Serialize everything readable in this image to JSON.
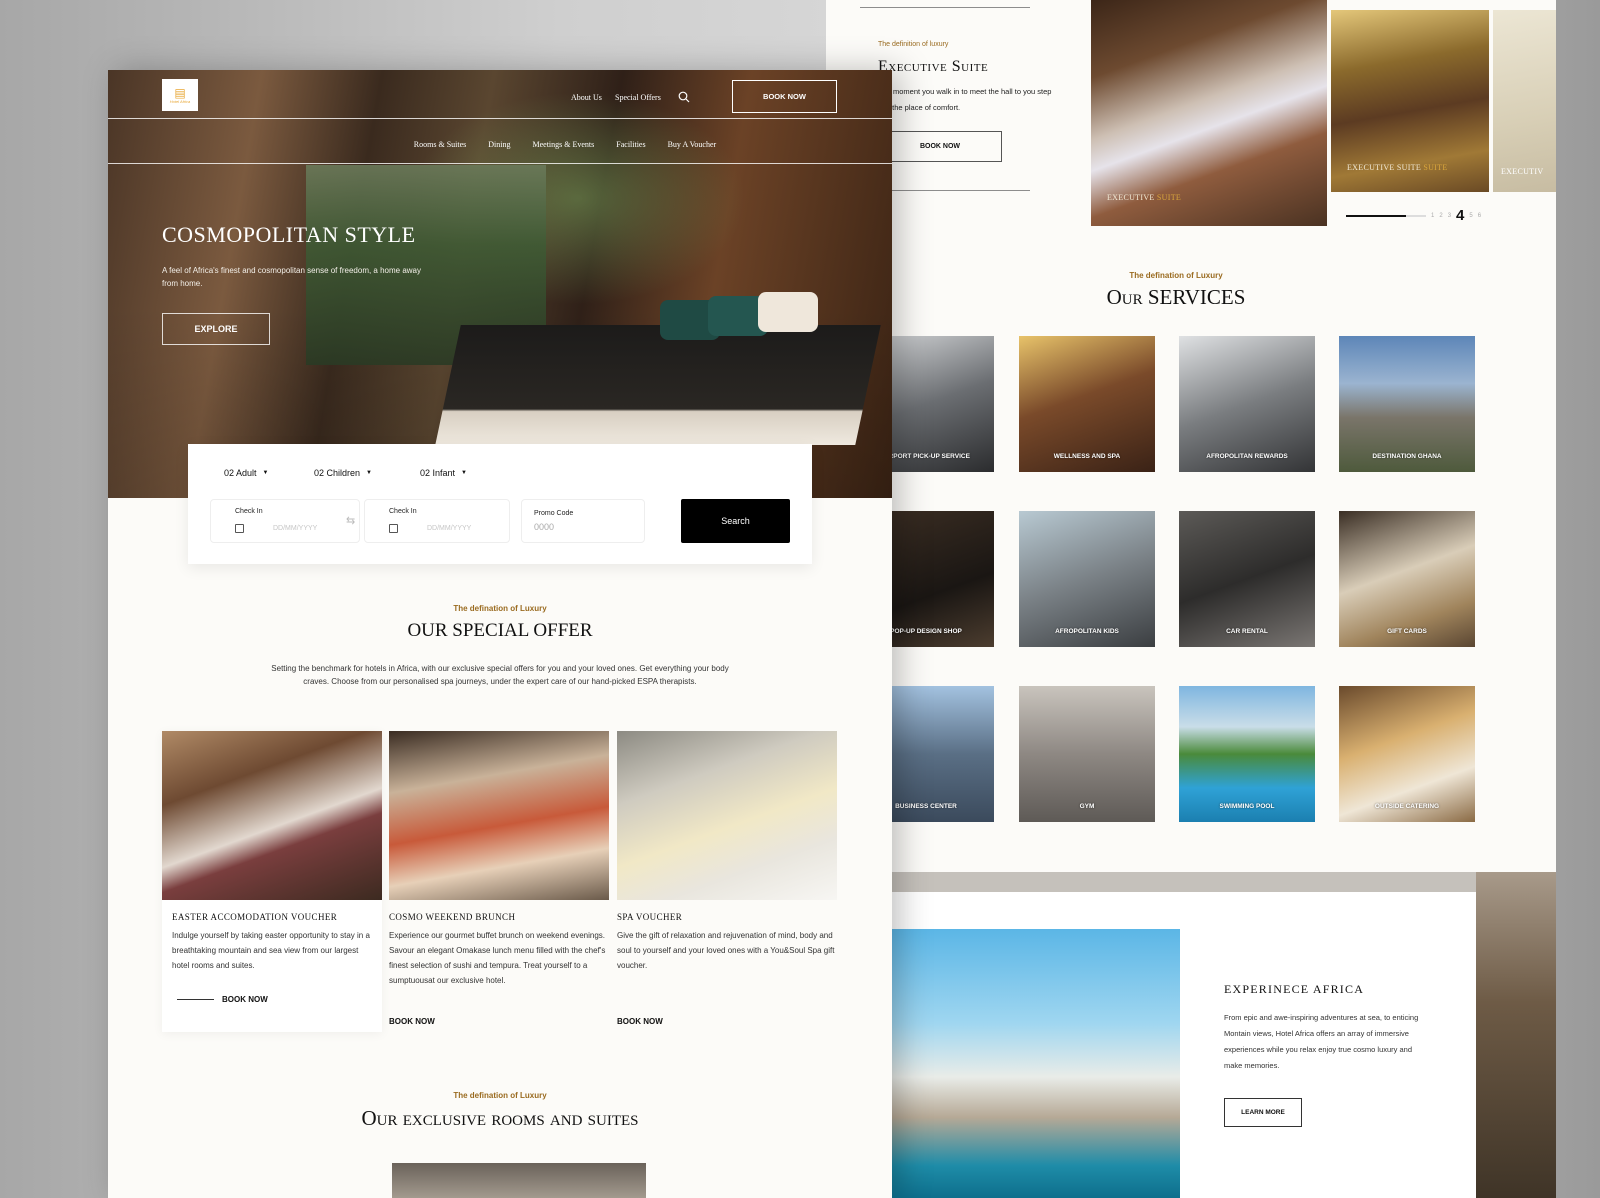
{
  "front": {
    "logo": {
      "glyph": "🏨",
      "tagline": "Hotel Africa"
    },
    "nav_top": [
      "About Us",
      "Special Offers"
    ],
    "book_now": "BOOK NOW",
    "nav_menu": [
      "Rooms & Suites",
      "Dining",
      "Meetings & Events",
      "Facilities",
      "Buy A Voucher"
    ],
    "hero": {
      "title": "COSMOPOLITAN STYLE",
      "subtitle": "A feel of Africa's finest and cosmopolitan sense of freedom, a home away from home.",
      "cta": "EXPLORE"
    },
    "booking": {
      "guests": [
        {
          "label": "02 Adult"
        },
        {
          "label": "02 Children"
        },
        {
          "label": "02 Infant"
        }
      ],
      "check_in_1": {
        "label": "Check In",
        "placeholder": "DD/MM/YYYY"
      },
      "check_in_2": {
        "label": "Check In",
        "placeholder": "DD/MM/YYYY"
      },
      "promo": {
        "label": "Promo Code",
        "placeholder": "0000"
      },
      "search": "Search"
    },
    "special_offer": {
      "eyebrow": "The defination of Luxury",
      "title": "OUR SPECIAL OFFER",
      "description": "Setting the benchmark for hotels in Africa, with our exclusive special offers for you and your loved ones. Get everything your body craves. Choose from our personalised spa journeys, under the expert care of our hand-picked ESPA therapists.",
      "offers": [
        {
          "title": "Easter Accomodation Voucher",
          "description": "Indulge yourself by taking easter opportunity to stay in a breathtaking mountain and sea view from our largest hotel rooms and suites.",
          "cta": "BOOK NOW"
        },
        {
          "title": "Cosmo Weekend Brunch",
          "description": "Experience our gourmet buffet brunch on weekend evenings. Savour an elegant Omakase lunch menu filled with the chef's finest selection of sushi and tempura. Treat yourself to a sumptuousat our exclusive hotel.",
          "cta": "BOOK NOW"
        },
        {
          "title": "Spa Voucher",
          "description": "Give the gift of relaxation and rejuvenation of mind, body and soul to yourself and your loved ones with a You&Soul Spa gift voucher.",
          "cta": "BOOK NOW"
        }
      ]
    },
    "rooms": {
      "eyebrow": "The defination of Luxury",
      "title": "Our exclusive rooms and suites"
    }
  },
  "back": {
    "suite": {
      "eyebrow": "The definition of luxury",
      "title": "Executive Suite",
      "description": "The moment you walk in to meet the hall to you step into the place of comfort.",
      "cta": "BOOK NOW"
    },
    "slides": [
      {
        "caption_main": "EXECUTIVE",
        "caption_accent": "SUITE"
      },
      {
        "caption_main": "EXECUTIVE SUITE",
        "caption_accent": "SUITE"
      },
      {
        "caption_main": "EXECUTIV",
        "caption_accent": ""
      }
    ],
    "pager": {
      "pages": [
        "1",
        "2",
        "3",
        "4",
        "5",
        "6"
      ],
      "current": "4",
      "progress": 0.75
    },
    "services": {
      "eyebrow": "The defination of Luxury",
      "title": "Our SERVICES",
      "items": [
        "AIRPORT PICK-UP SERVICE",
        "WELLNESS AND SPA",
        "AFROPOLITAN REWARDS",
        "DESTINATION GHANA",
        "POP-UP DESIGN SHOP",
        "AFROPOLITAN KIDS",
        "CAR RENTAL",
        "GIFT CARDS",
        "BUSINESS CENTER",
        "GYM",
        "SWIMMING POOL",
        "OUTSIDE CATERING"
      ]
    },
    "experience": {
      "title": "EXPERINECE AFRICA",
      "description": "From epic and awe-inspiring adventures at sea, to enticing Montain views, Hotel Africa offers an array of immersive experiences while you relax enjoy true cosmo luxury and make memories.",
      "cta": "LEARN MORE"
    }
  }
}
